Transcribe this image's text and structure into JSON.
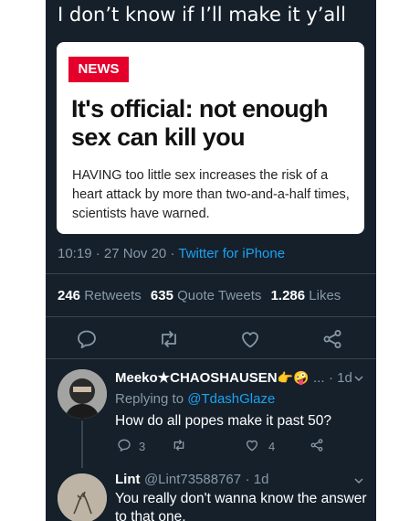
{
  "caption": "I don’t know if I’ll make it y’all",
  "card": {
    "tag": "NEWS",
    "headline": "It's official: not enough sex can kill you",
    "body": "HAVING too little sex increases the risk of a heart attack by more than two-and-a-half times, scientists have warned."
  },
  "meta": {
    "time": "10:19",
    "sep": "·",
    "date": "27 Nov 20",
    "source": "Twitter for iPhone"
  },
  "stats": {
    "retweets_count": "246",
    "retweets_label": "Retweets",
    "quotes_count": "635",
    "quotes_label": "Quote Tweets",
    "likes_count": "1.286",
    "likes_label": "Likes"
  },
  "actions": [
    "reply-icon",
    "retweet-icon",
    "like-icon",
    "share-icon"
  ],
  "replies": [
    {
      "name": "Meeko★CHAOSHAUSEN",
      "emoji": "👉🤪",
      "ellipsis": "...",
      "age": "· 1d",
      "replying_label": "Replying to",
      "replying_handle": "@TdashGlaze",
      "text": "How do all popes make it past 50?",
      "reply_count": "3",
      "like_count": "4"
    },
    {
      "name": "Lint",
      "handle": "@Lint73588767",
      "age": "· 1d",
      "text": "You really don't wanna know the answer to that one."
    }
  ],
  "colors": {
    "background": "#15202b",
    "accent": "#1da1f2",
    "muted": "#8899a6",
    "news_red": "#e4002b"
  }
}
